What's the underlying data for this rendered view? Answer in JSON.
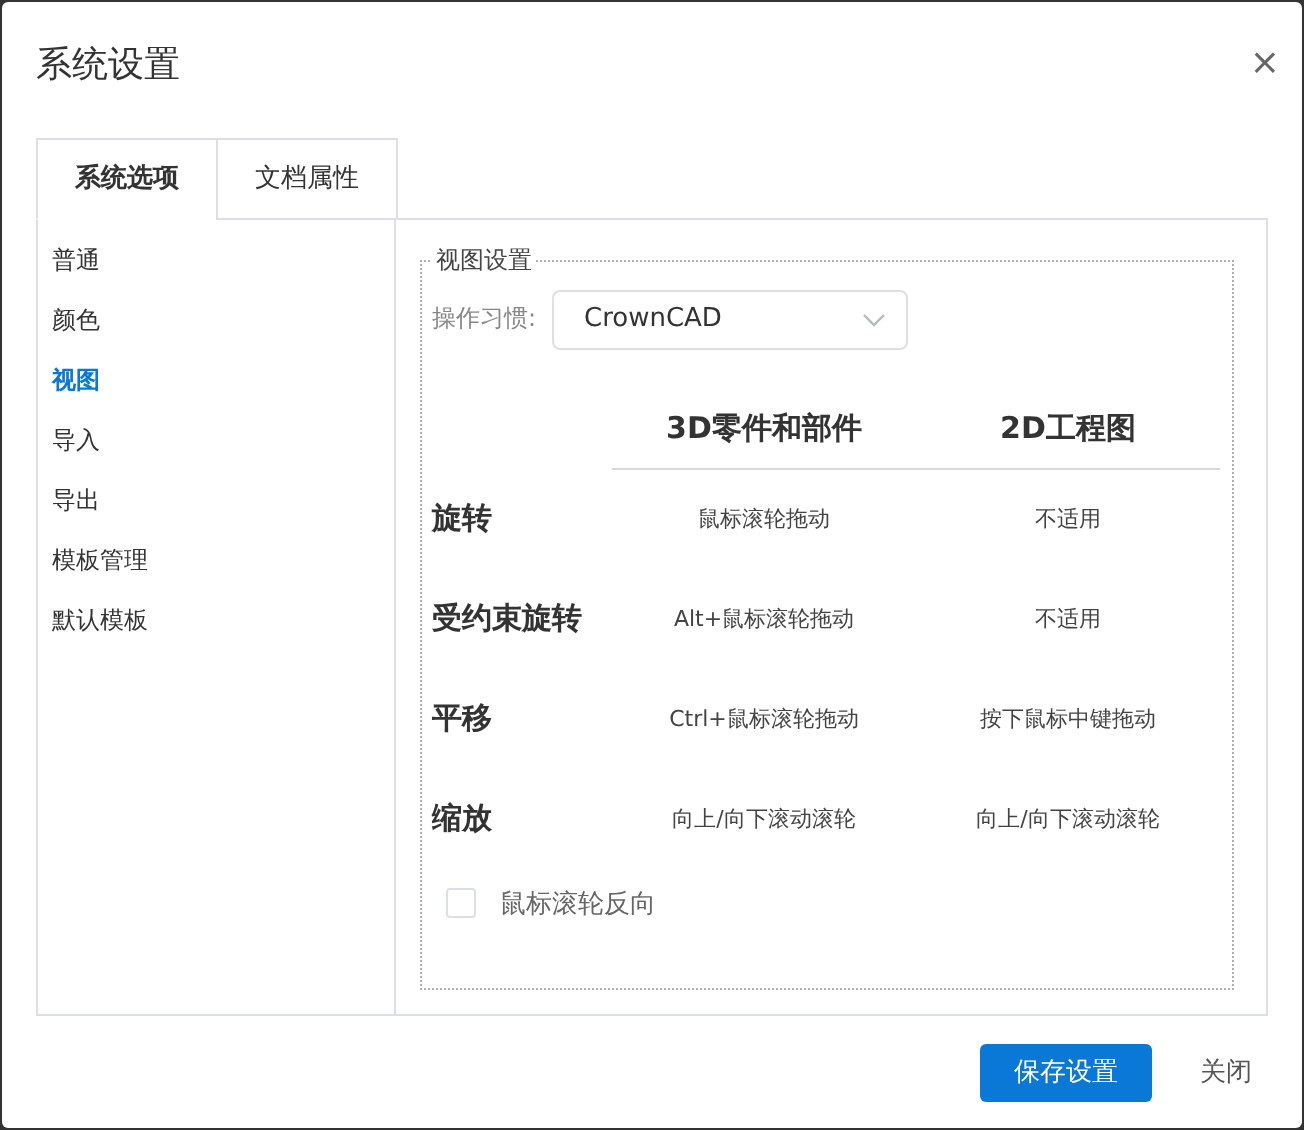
{
  "dialog": {
    "title": "系统设置",
    "close": "×"
  },
  "tabs": [
    {
      "label": "系统选项",
      "selected": true
    },
    {
      "label": "文档属性",
      "selected": false
    }
  ],
  "sidebar": {
    "items": [
      {
        "label": "普通",
        "selected": false
      },
      {
        "label": "颜色",
        "selected": false
      },
      {
        "label": "视图",
        "selected": true
      },
      {
        "label": "导入",
        "selected": false
      },
      {
        "label": "导出",
        "selected": false
      },
      {
        "label": "模板管理",
        "selected": false
      },
      {
        "label": "默认模板",
        "selected": false
      }
    ]
  },
  "view_settings": {
    "legend": "视图设置",
    "habit_label": "操作习惯:",
    "habit_value": "CrownCAD",
    "columns": [
      "3D零件和部件",
      "2D工程图"
    ],
    "rows": [
      {
        "action": "旋转",
        "cells": [
          "鼠标滚轮拖动",
          "不适用"
        ]
      },
      {
        "action": "受约束旋转",
        "cells": [
          "Alt+鼠标滚轮拖动",
          "不适用"
        ]
      },
      {
        "action": "平移",
        "cells": [
          "Ctrl+鼠标滚轮拖动",
          "按下鼠标中键拖动"
        ]
      },
      {
        "action": "缩放",
        "cells": [
          "向上/向下滚动滚轮",
          "向上/向下滚动滚轮"
        ]
      }
    ],
    "reverse_wheel": {
      "label": "鼠标滚轮反向",
      "checked": false
    }
  },
  "buttons": [
    {
      "label": "保存设置",
      "kind": "primary"
    },
    {
      "label": "关闭",
      "kind": "text"
    }
  ]
}
